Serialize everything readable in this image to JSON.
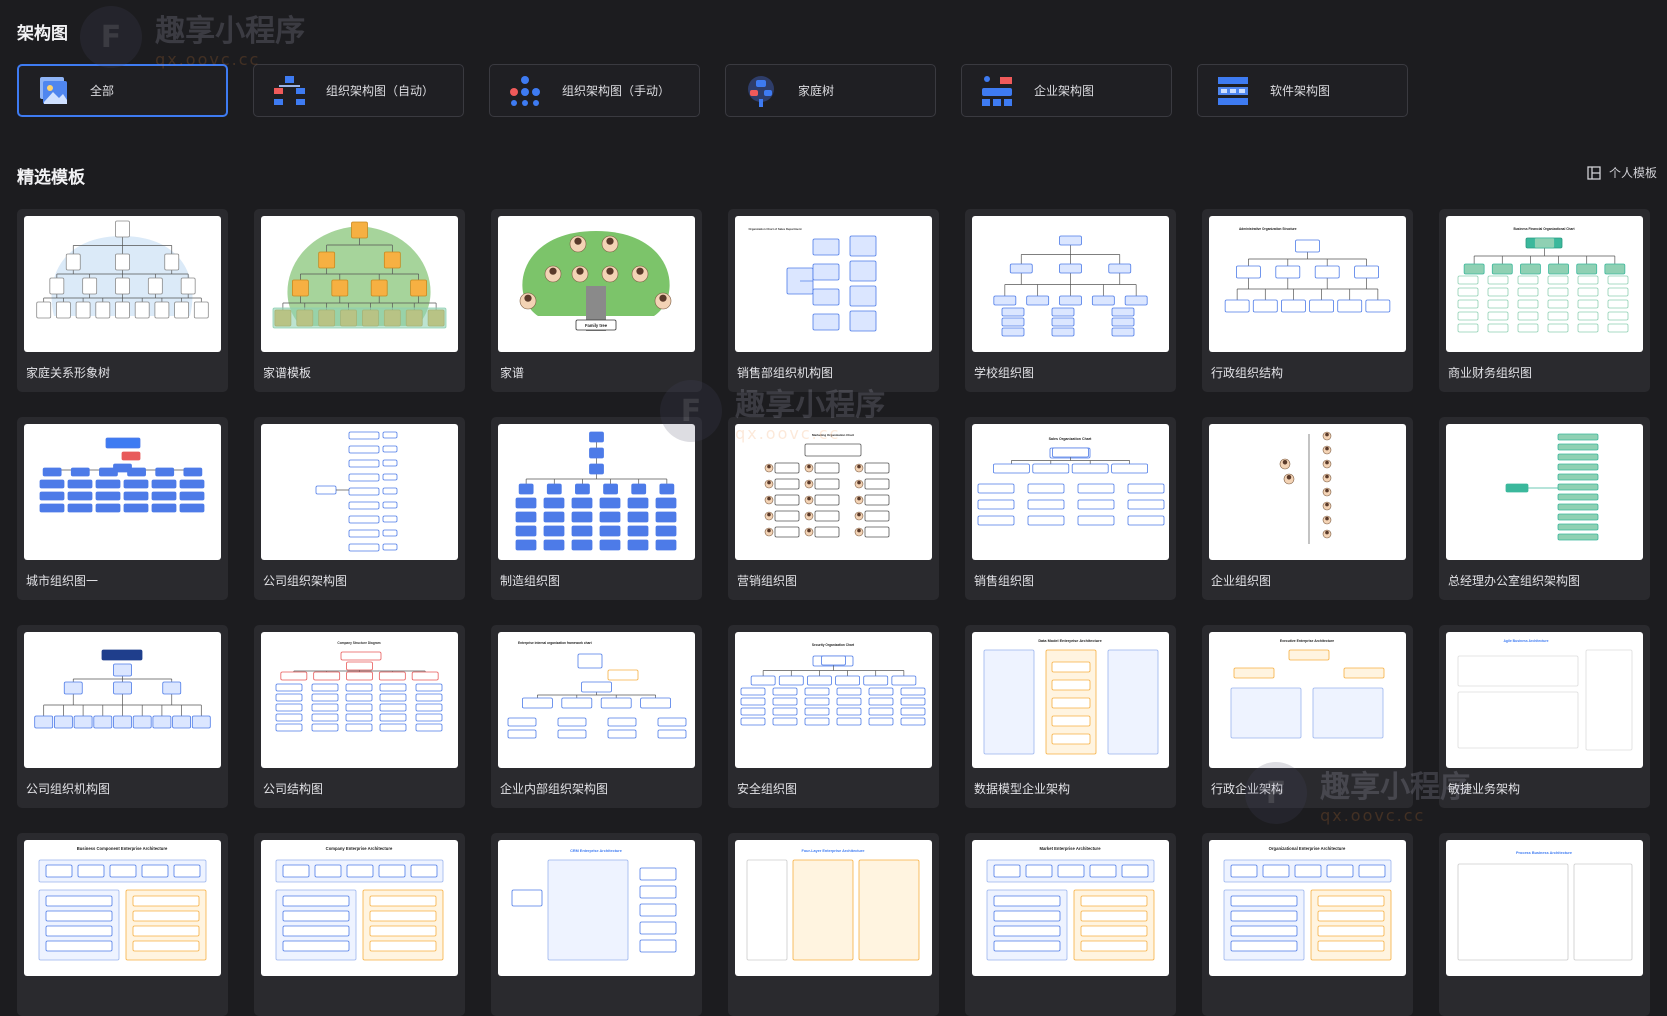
{
  "section_title": "架构图",
  "categories": [
    {
      "label": "全部",
      "icon": "image-stack-icon",
      "active": true
    },
    {
      "label": "组织架构图（自动）",
      "icon": "org-chart-icon"
    },
    {
      "label": "组织架构图（手动）",
      "icon": "network-icon"
    },
    {
      "label": "家庭树",
      "icon": "family-tree-icon"
    },
    {
      "label": "企业架构图",
      "icon": "enterprise-icon"
    },
    {
      "label": "软件架构图",
      "icon": "software-layers-icon"
    }
  ],
  "featured_title": "精选模板",
  "personal_templates_label": "个人模板",
  "templates": [
    {
      "name": "家庭关系形象树"
    },
    {
      "name": "家谱模板"
    },
    {
      "name": "家谱",
      "thumb_text": "Family tree"
    },
    {
      "name": "销售部组织机构图",
      "thumb_text": "Organization Chart of Sales Department"
    },
    {
      "name": "学校组织图"
    },
    {
      "name": "行政组织结构",
      "thumb_text": "Administrative Organization Structure"
    },
    {
      "name": "商业财务组织图",
      "thumb_text": "Business Financial Organizational Chart"
    },
    {
      "name": "城市组织图一"
    },
    {
      "name": "公司组织架构图"
    },
    {
      "name": "制造组织图"
    },
    {
      "name": "营销组织图",
      "thumb_text": "Marketing Organization Chart"
    },
    {
      "name": "销售组织图",
      "thumb_text": "Sales Organization Chart"
    },
    {
      "name": "企业组织图"
    },
    {
      "name": "总经理办公室组织架构图"
    },
    {
      "name": "公司组织机构图"
    },
    {
      "name": "公司结构图",
      "thumb_text": "Company Structure Diagram"
    },
    {
      "name": "企业内部组织架构图",
      "thumb_text": "Enterprise internal organization framework chart"
    },
    {
      "name": "安全组织图",
      "thumb_text": "Security Organization Chart"
    },
    {
      "name": "数据模型企业架构",
      "thumb_text": "Data Model Enterprise Architecture"
    },
    {
      "name": "行政企业架构",
      "thumb_text": "Executive Enterprise Architecture"
    },
    {
      "name": "敏捷业务架构",
      "thumb_text": "Agile Business Architecture"
    },
    {
      "name": "",
      "thumb_text": "Business Component Enterprise Architecture"
    },
    {
      "name": "",
      "thumb_text": "Company Enterprise Architecture"
    },
    {
      "name": "",
      "thumb_text": "CRM Enterprise Architecture"
    },
    {
      "name": "",
      "thumb_text": "Four-Layer Enterprise Architecture"
    },
    {
      "name": "",
      "thumb_text": "Market Enterprise Architecture"
    },
    {
      "name": "",
      "thumb_text": "Organizational Enterprise Architecture"
    },
    {
      "name": "",
      "thumb_text": "Process Business Architecture"
    }
  ],
  "watermark": {
    "line1": "趣享小程序",
    "line2": "qx.oovc.cc",
    "logo": "F"
  },
  "colors": {
    "accent": "#3e7bf2",
    "bg": "#1c1c1f",
    "card": "#2a2a2e"
  }
}
